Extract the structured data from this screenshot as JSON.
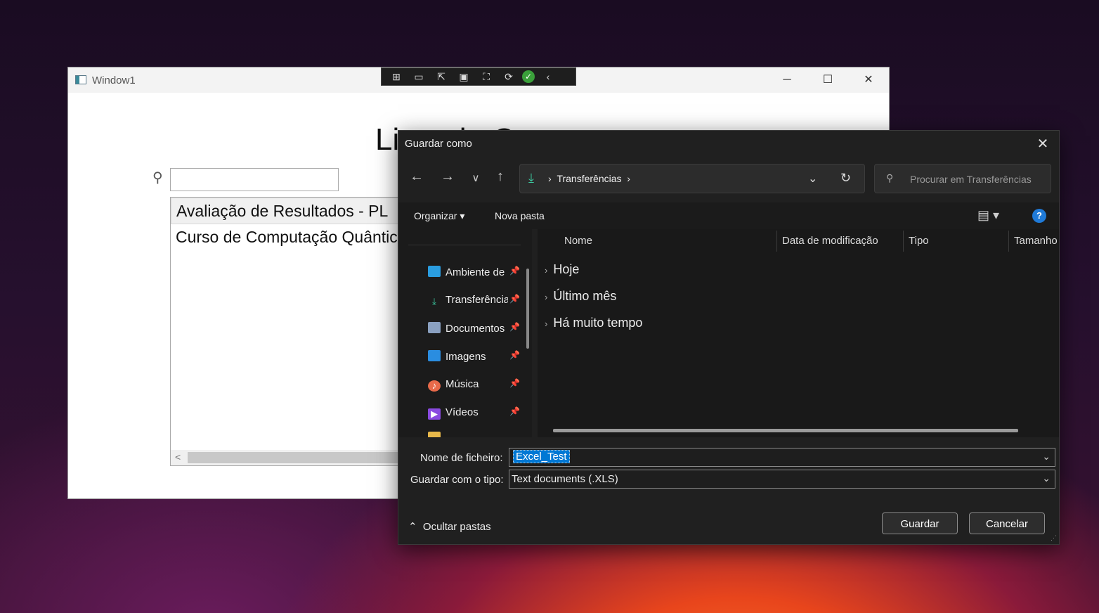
{
  "window1": {
    "title": "Window1",
    "heading": "Lista de Cursos",
    "search_value": "",
    "list_items": [
      "Avaliação de Resultados - PL",
      "Curso de Computação Quântica"
    ],
    "scroll_left": "<"
  },
  "debug_toolbar": {
    "icons": [
      "visual-tree-icon",
      "camera-icon",
      "select-element-icon",
      "display-layout-icon",
      "track-focus-icon",
      "hot-reload-icon",
      "check-icon",
      "collapse-icon"
    ]
  },
  "dialog": {
    "title": "Guardar como",
    "address": {
      "folder": "Transferências"
    },
    "search_placeholder": "Procurar em Transferências",
    "commands": {
      "organize": "Organizar ▾",
      "new_folder": "Nova pasta",
      "help": "?"
    },
    "nav_items": [
      {
        "label": "Ambiente de",
        "icon": "desktop-icon",
        "color": "#2a9de0"
      },
      {
        "label": "Transferência",
        "icon": "download-icon",
        "color": "#3cc9a0"
      },
      {
        "label": "Documentos",
        "icon": "document-icon",
        "color": "#8aa0c0"
      },
      {
        "label": "Imagens",
        "icon": "pictures-icon",
        "color": "#2a8de0"
      },
      {
        "label": "Música",
        "icon": "music-icon",
        "color": "#e86a4a"
      },
      {
        "label": "Vídeos",
        "icon": "videos-icon",
        "color": "#8a4ae0"
      }
    ],
    "columns": [
      "Nome",
      "Data de modificação",
      "Tipo",
      "Tamanho"
    ],
    "groups": [
      "Hoje",
      "Último mês",
      "Há muito tempo"
    ],
    "filename_label": "Nome de ficheiro:",
    "filename_value": "Excel_Test",
    "filetype_label": "Guardar com o tipo:",
    "filetype_value": "Text documents (.XLS)",
    "hide_folders": "Ocultar pastas",
    "save_button": "Guardar",
    "cancel_button": "Cancelar"
  }
}
